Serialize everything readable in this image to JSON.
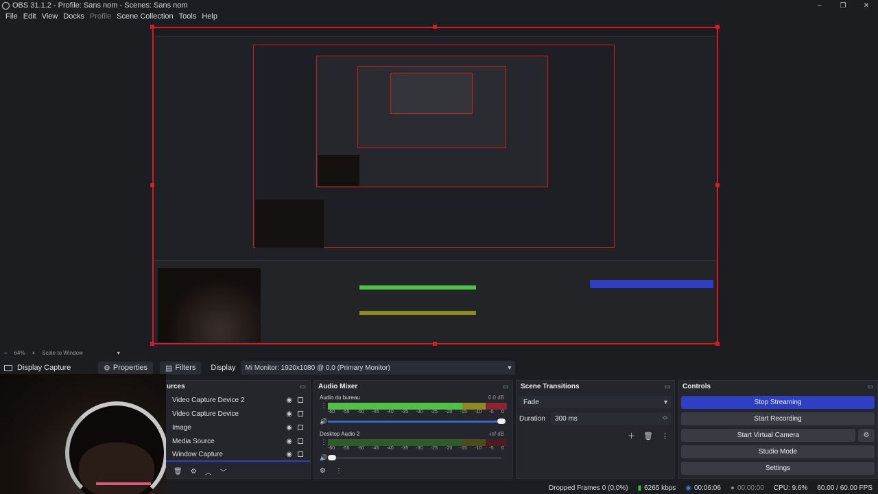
{
  "window": {
    "title": "OBS 31.1.2 - Profile: Sans nom - Scenes: Sans nom",
    "minimize": "–",
    "maximize": "❐",
    "close": "✕"
  },
  "menu": {
    "items": [
      "File",
      "Edit",
      "View",
      "Docks",
      "Profile",
      "Scene Collection",
      "Tools",
      "Help"
    ]
  },
  "zoom": {
    "zoom_label": "64%",
    "scale_label": "Scale to Window"
  },
  "source_toolbar": {
    "source_name": "Display Capture",
    "properties": "Properties",
    "filters": "Filters",
    "display_label": "Display",
    "display_value": "Mi Monitor: 1920x1080 @ 0,0 (Primary Monitor)"
  },
  "sources": {
    "title": "urces",
    "items": [
      "Video Capture Device 2",
      "Video Capture Device",
      "Image",
      "Media Source",
      "Window Capture"
    ]
  },
  "audio_mixer": {
    "title": "Audio Mixer",
    "channels": [
      {
        "name": "Audio du bureau",
        "db": "0.0 dB",
        "level": 0.92
      },
      {
        "name": "Desktop Audio 2",
        "db": "-inf dB",
        "level": 0.0
      }
    ],
    "ticks": [
      "-60",
      "-55",
      "-50",
      "-45",
      "-40",
      "-35",
      "-30",
      "-25",
      "-20",
      "-15",
      "-10",
      "-5",
      "0"
    ]
  },
  "transitions": {
    "title": "Scene Transitions",
    "selected": "Fade",
    "duration_label": "Duration",
    "duration_value": "300 ms"
  },
  "controls": {
    "title": "Controls",
    "stop_streaming": "Stop Streaming",
    "start_recording": "Start Recording",
    "start_virtual_camera": "Start Virtual Camera",
    "studio_mode": "Studio Mode",
    "settings": "Settings"
  },
  "status": {
    "dropped_frames": "Dropped Frames 0 (0,0%)",
    "bitrate": "6265 kbps",
    "stream_time": "00:06:06",
    "rec_time": "00:00:00",
    "cpu": "CPU: 9.6%",
    "fps": "60.00 / 60.00 FPS"
  },
  "colors": {
    "accent": "#2f3fc3",
    "selection": "#d41c27",
    "meter_green": "#4fc246",
    "meter_yellow": "#8d8a24",
    "meter_red": "#8a2430",
    "bitrate_icon": "#35c44a",
    "stream_icon": "#3c7bd9"
  }
}
